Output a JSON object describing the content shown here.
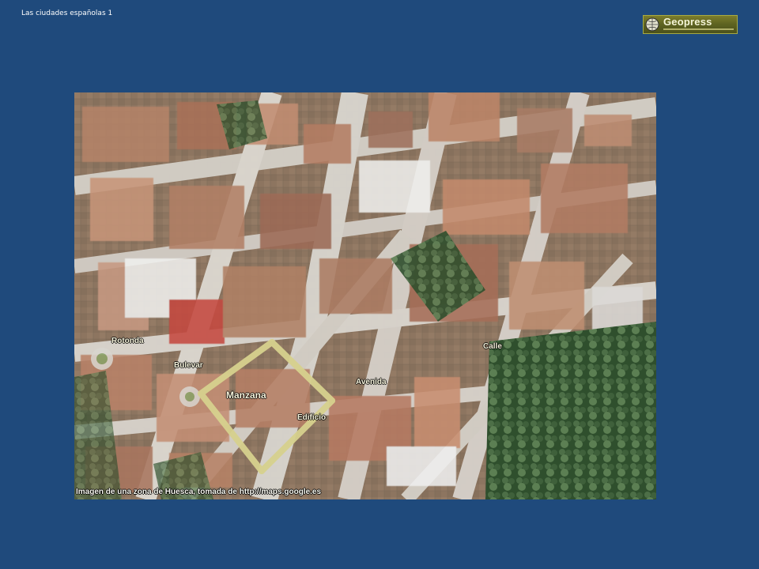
{
  "slide": {
    "title": "Las ciudades españolas 1",
    "background_color": "#1f4a7c"
  },
  "logo": {
    "text": "Geopress",
    "icon": "globe-icon"
  },
  "map": {
    "caption": "Imagen de una zona de Huesca, tomada de http://maps.google.es",
    "labels": {
      "rotonda": "Rotonda",
      "bulevar": "Bulevar",
      "manzana": "Manzana",
      "edificio": "Edificio",
      "avenida": "Avenida",
      "calle": "Calle"
    }
  }
}
